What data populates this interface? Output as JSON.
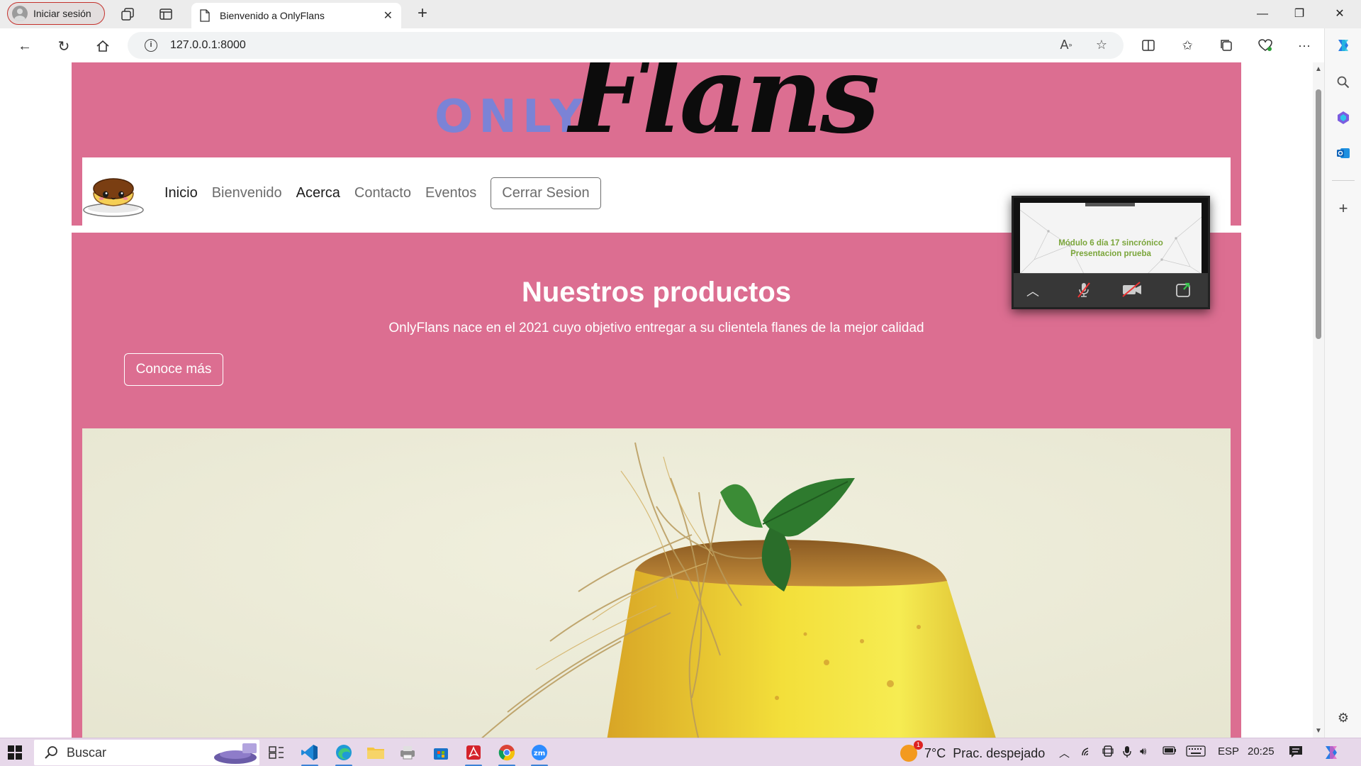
{
  "browser": {
    "profile_label": "Iniciar sesión",
    "tab_title": "Bienvenido a OnlyFlans",
    "url": "127.0.0.1:8000"
  },
  "site": {
    "logo_only": "ONLY",
    "logo_flans": "Flans",
    "nav": {
      "inicio": "Inicio",
      "bienvenido": "Bienvenido",
      "acerca": "Acerca",
      "contacto": "Contacto",
      "eventos": "Eventos",
      "logout": "Cerrar Sesion"
    },
    "hero": {
      "title": "Nuestros productos",
      "subtitle": "OnlyFlans nace en el 2021 cuyo objetivo entregar a su clientela flanes de la mejor calidad",
      "cta": "Conoce más"
    },
    "colors": {
      "page_background": "#dc6e91",
      "logo_only": "#7b83d6",
      "nav_active": "#1c1c1c",
      "nav_inactive": "#6c6c6c"
    }
  },
  "zoom_window": {
    "slide_line1": "Módulo 6 día 17 sincrónico",
    "slide_line2": "Presentacion prueba",
    "controls": [
      "expand-icon",
      "mic-muted-icon",
      "camera-off-icon",
      "share-icon"
    ]
  },
  "taskbar": {
    "search_label": "Buscar",
    "weather_temp": "7°C",
    "weather_desc": "Prac. despejado",
    "language": "ESP",
    "time": "20:25",
    "weather_badge": "1"
  }
}
